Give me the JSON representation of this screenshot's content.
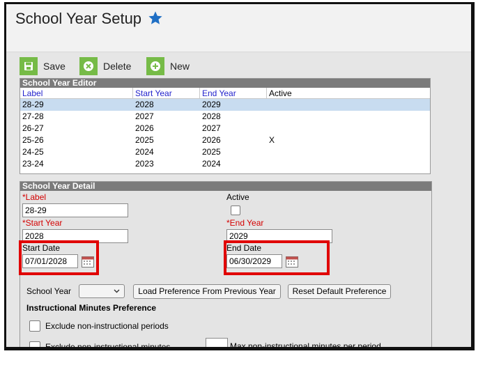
{
  "header": {
    "title": "School Year Setup",
    "star_icon": "star-icon"
  },
  "toolbar": {
    "save_label": "Save",
    "delete_label": "Delete",
    "new_label": "New"
  },
  "editor": {
    "title": "School Year Editor",
    "columns": [
      "Label",
      "Start Year",
      "End Year",
      "Active"
    ],
    "rows": [
      [
        "28-29",
        "2028",
        "2029",
        ""
      ],
      [
        "27-28",
        "2027",
        "2028",
        ""
      ],
      [
        "26-27",
        "2026",
        "2027",
        ""
      ],
      [
        "25-26",
        "2025",
        "2026",
        "X"
      ],
      [
        "24-25",
        "2024",
        "2025",
        ""
      ],
      [
        "23-24",
        "2023",
        "2024",
        ""
      ]
    ]
  },
  "detail": {
    "title": "School Year Detail",
    "label_field": {
      "label": "Label",
      "value": "28-29"
    },
    "active_label": "Active",
    "start_year": {
      "label": "Start Year",
      "value": "2028"
    },
    "end_year": {
      "label": "End Year",
      "value": "2029"
    },
    "start_date": {
      "label": "Start Date",
      "value": "07/01/2028"
    },
    "end_date": {
      "label": "End Date",
      "value": "06/30/2029"
    },
    "school_year_label": "School Year",
    "load_pref_button": "Load Preference From Previous Year",
    "reset_pref_button": "Reset Default Preference",
    "instr_heading": "Instructional Minutes Preference",
    "exclude_periods": "Exclude non-instructional periods",
    "exclude_minutes": "Exclude non-instructional minutes",
    "max_minutes": "Max non-instructional minutes per period"
  }
}
